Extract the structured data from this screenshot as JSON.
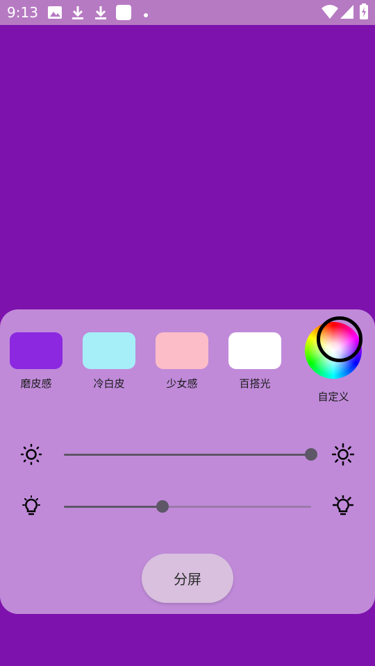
{
  "status_bar": {
    "time": "9:13",
    "icons": [
      "image-icon",
      "download-icon",
      "download-icon",
      "app-square-icon",
      "dot-icon",
      "wifi-icon",
      "signal-icon",
      "battery-charging-icon"
    ]
  },
  "presets": [
    {
      "label": "磨皮感",
      "color": "#8b28e0"
    },
    {
      "label": "冷白皮",
      "color": "#a6eff8"
    },
    {
      "label": "少女感",
      "color": "#fcbdc8"
    },
    {
      "label": "百搭光",
      "color": "#ffffff"
    }
  ],
  "custom": {
    "label": "自定义"
  },
  "sliders": [
    {
      "name": "brightness",
      "value": 1.0
    },
    {
      "name": "color-temperature",
      "value": 0.4
    }
  ],
  "split_button": {
    "label": "分屏"
  },
  "colors": {
    "background": "#7e12ad",
    "panel": "#c08ad9",
    "status_bar": "#b67ac2",
    "slider_active": "#5d5767"
  }
}
